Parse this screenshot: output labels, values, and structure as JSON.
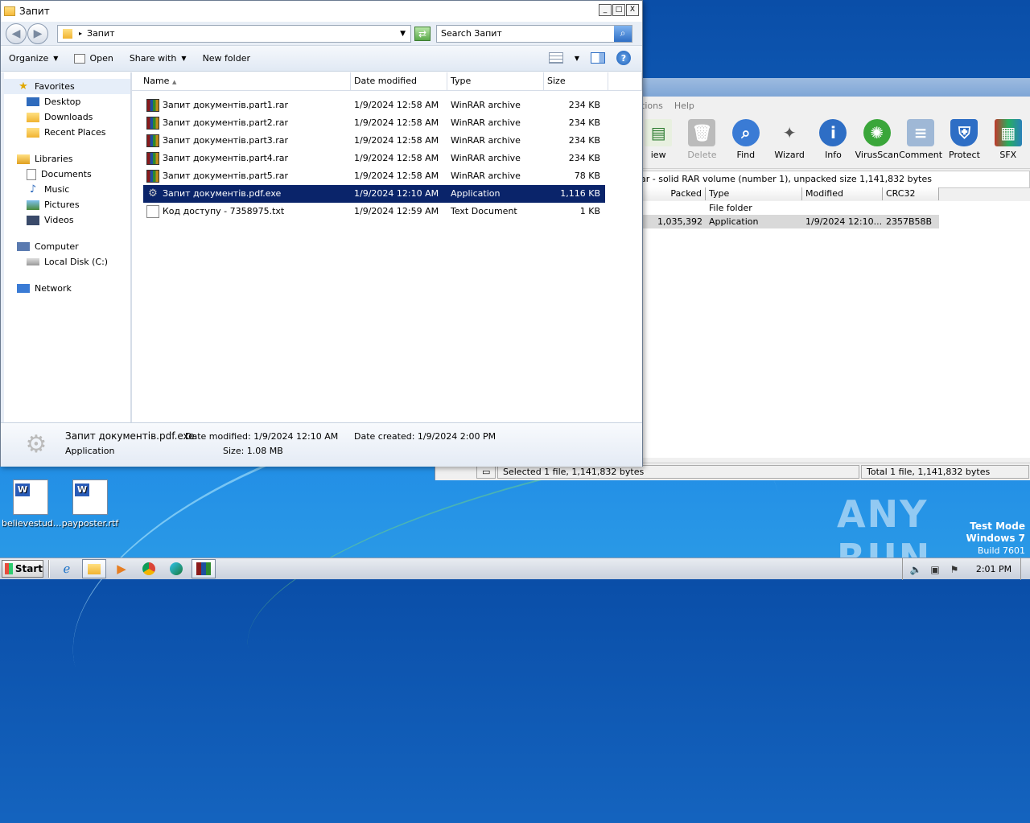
{
  "explorer": {
    "title": "Запит",
    "window_controls": {
      "minimize": "_",
      "maximize": "□",
      "close": "X"
    },
    "address": "Запит",
    "search_placeholder": "Search Запит",
    "commands": {
      "organize": "Organize",
      "open": "Open",
      "share_with": "Share with",
      "new_folder": "New folder"
    },
    "columns": {
      "name": "Name",
      "date": "Date modified",
      "type": "Type",
      "size": "Size"
    },
    "nav": {
      "favorites": "Favorites",
      "desktop": "Desktop",
      "downloads": "Downloads",
      "recent": "Recent Places",
      "libraries": "Libraries",
      "documents": "Documents",
      "music": "Music",
      "pictures": "Pictures",
      "videos": "Videos",
      "computer": "Computer",
      "local_disk": "Local Disk (C:)",
      "network": "Network"
    },
    "files": [
      {
        "name": "Запит документів.part1.rar",
        "date": "1/9/2024 12:58 AM",
        "type": "WinRAR archive",
        "size": "234 KB",
        "icon": "rar-icon"
      },
      {
        "name": "Запит документів.part2.rar",
        "date": "1/9/2024 12:58 AM",
        "type": "WinRAR archive",
        "size": "234 KB",
        "icon": "rar-icon"
      },
      {
        "name": "Запит документів.part3.rar",
        "date": "1/9/2024 12:58 AM",
        "type": "WinRAR archive",
        "size": "234 KB",
        "icon": "rar-icon"
      },
      {
        "name": "Запит документів.part4.rar",
        "date": "1/9/2024 12:58 AM",
        "type": "WinRAR archive",
        "size": "234 KB",
        "icon": "rar-icon"
      },
      {
        "name": "Запит документів.part5.rar",
        "date": "1/9/2024 12:58 AM",
        "type": "WinRAR archive",
        "size": "78 KB",
        "icon": "rar-icon"
      },
      {
        "name": "Запит документів.pdf.exe",
        "date": "1/9/2024 12:10 AM",
        "type": "Application",
        "size": "1,116 KB",
        "icon": "exe-icon",
        "selected": true
      },
      {
        "name": "Код доступу - 7358975.txt",
        "date": "1/9/2024 12:59 AM",
        "type": "Text Document",
        "size": "1 KB",
        "icon": "txt-icon"
      }
    ],
    "details": {
      "name": "Запит документів.pdf.exe",
      "type": "Application",
      "date_modified": "Date modified: 1/9/2024 12:10 AM",
      "size": "Size: 1.08 MB",
      "date_created": "Date created: 1/9/2024 2:00 PM"
    }
  },
  "winrar": {
    "menu": [
      "tions",
      "Help"
    ],
    "toolbar": [
      "iew",
      "Delete",
      "Find",
      "Wizard",
      "Info",
      "VirusScan",
      "Comment",
      "Protect",
      "SFX"
    ],
    "path": "ar - solid RAR volume (number 1), unpacked size 1,141,832 bytes",
    "columns": [
      "Packed",
      "Type",
      "Modified",
      "CRC32"
    ],
    "rows": [
      {
        "packed": "",
        "type": "File folder",
        "modified": "",
        "crc": ""
      },
      {
        "packed": "1,035,392",
        "type": "Application",
        "modified": "1/9/2024 12:10...",
        "crc": "2357B58B"
      }
    ],
    "status_left": "Selected 1 file, 1,141,832 bytes",
    "status_right": "Total 1 file, 1,141,832 bytes"
  },
  "desktop": {
    "icons": [
      {
        "label": "believestud..."
      },
      {
        "label": "payposter.rtf"
      }
    ],
    "watermark": "ANY RUN",
    "testmode": {
      "line1": "Test Mode",
      "line2": "Windows 7",
      "line3": "Build 7601"
    }
  },
  "taskbar": {
    "start": "Start",
    "clock": "2:01 PM"
  }
}
